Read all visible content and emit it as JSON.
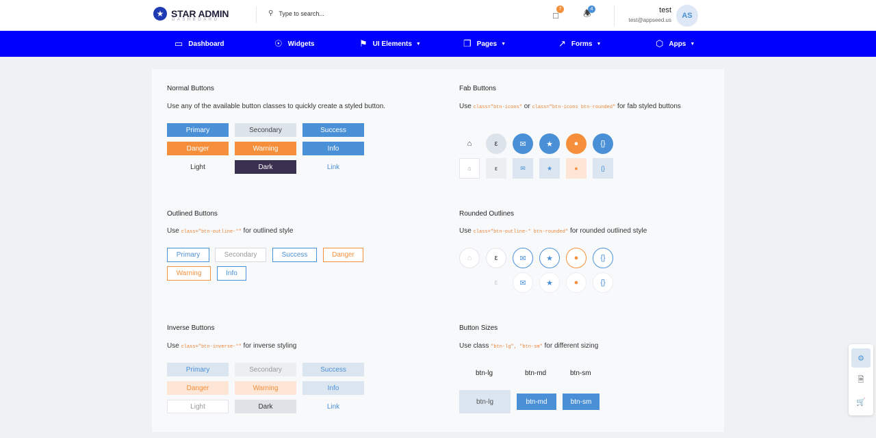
{
  "header": {
    "logo_title": "STAR ADMIN",
    "logo_subtitle": "DASHBOARD",
    "search_placeholder": "Type to search...",
    "notifications_count": "7",
    "alerts_count": "4",
    "user_name": "test",
    "user_email": "test@appseed.us",
    "avatar_initials": "AS"
  },
  "nav": {
    "items": [
      {
        "label": "Dashboard"
      },
      {
        "label": "Widgets"
      },
      {
        "label": "UI Elements"
      },
      {
        "label": "Pages"
      },
      {
        "label": "Forms"
      },
      {
        "label": "Apps"
      }
    ]
  },
  "normal": {
    "title": "Normal Buttons",
    "desc": "Use any of the available button classes to quickly create a styled button.",
    "buttons": [
      "Primary",
      "Secondary",
      "Success",
      "Danger",
      "Warning",
      "Info",
      "Light",
      "Dark",
      "Link"
    ]
  },
  "fab": {
    "title": "Fab Buttons",
    "desc_pre": "Use ",
    "code1": "class=\"btn-icons\"",
    "desc_mid": " or ",
    "code2": "class=\"btn-icons btn-rounded\"",
    "desc_post": " for fab styled buttons"
  },
  "outlined": {
    "title": "Outlined Buttons",
    "desc_pre": "Use ",
    "code": "class=\"btn-outline-*\"",
    "desc_post": " for outlined style",
    "buttons": [
      "Primary",
      "Secondary",
      "Success",
      "Danger",
      "Warning",
      "Info"
    ]
  },
  "rounded": {
    "title": "Rounded Outlines",
    "desc_pre": "Use ",
    "code": "class=\"btn-outline-* btn-rounded\"",
    "desc_post": " for rounded outlined style"
  },
  "inverse": {
    "title": "Inverse Buttons",
    "desc_pre": "Use ",
    "code": "class=\"btn-inverse-*\"",
    "desc_post": " for inverse styling",
    "buttons": [
      "Primary",
      "Secondary",
      "Success",
      "Danger",
      "Warning",
      "Info",
      "Light",
      "Dark",
      "Link"
    ]
  },
  "sizes": {
    "title": "Button Sizes",
    "desc_pre": "Use class ",
    "code": "\"btn-lg\", \"btn-sm\"",
    "desc_post": " for different sizing",
    "labels": [
      "btn-lg",
      "btn-md",
      "btn-sm"
    ],
    "buttons": [
      "btn-lg",
      "btn-md",
      "btn-sm"
    ]
  },
  "colors": {
    "brand_blue": "#0000ff",
    "primary": "#4a90d6",
    "warning": "#f58f3b",
    "dark": "#3b3050"
  },
  "icons": [
    "home-icon",
    "edge-icon",
    "mail-icon",
    "star-icon",
    "location-icon",
    "code-icon",
    "settings-icon",
    "document-icon",
    "cart-icon"
  ]
}
